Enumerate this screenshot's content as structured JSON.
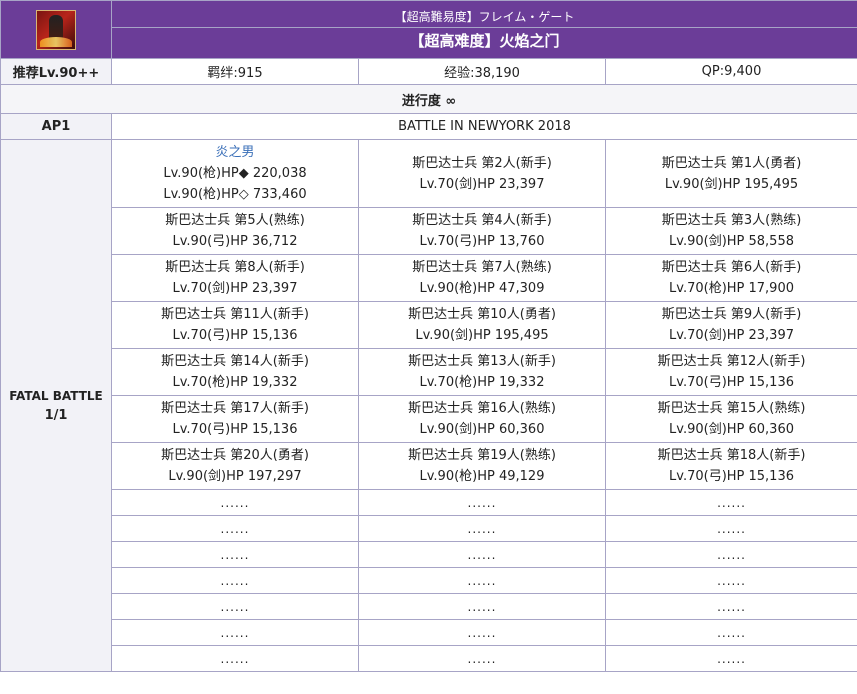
{
  "header": {
    "jp_title": "【超高難易度】フレイム・ゲート",
    "cn_title": "【超高难度】火焰之门",
    "icon": "flame-gate-quest-icon"
  },
  "info": {
    "level": "推荐Lv.90++",
    "bond": "羁绊:915",
    "exp": "经验:38,190",
    "qp": "QP:9,400"
  },
  "progress": "进行度 ∞",
  "ap": {
    "label": "AP1",
    "battle_name": "BATTLE IN NEWYORK 2018"
  },
  "fatal": {
    "label": "FATAL BATTLE",
    "ratio": "1/1"
  },
  "enemies": [
    [
      {
        "name": "炎之男",
        "lines": [
          "Lv.90(枪)HP◆ 220,038",
          "Lv.90(枪)HP◇ 733,460"
        ],
        "link": true
      },
      {
        "name": "斯巴达士兵 第2人(新手)",
        "lines": [
          "Lv.70(剑)HP 23,397"
        ]
      },
      {
        "name": "斯巴达士兵 第1人(勇者)",
        "lines": [
          "Lv.90(剑)HP 195,495"
        ]
      }
    ],
    [
      {
        "name": "斯巴达士兵 第5人(熟练)",
        "lines": [
          "Lv.90(弓)HP 36,712"
        ]
      },
      {
        "name": "斯巴达士兵 第4人(新手)",
        "lines": [
          "Lv.70(弓)HP 13,760"
        ]
      },
      {
        "name": "斯巴达士兵 第3人(熟练)",
        "lines": [
          "Lv.90(剑)HP 58,558"
        ]
      }
    ],
    [
      {
        "name": "斯巴达士兵 第8人(新手)",
        "lines": [
          "Lv.70(剑)HP 23,397"
        ]
      },
      {
        "name": "斯巴达士兵 第7人(熟练)",
        "lines": [
          "Lv.90(枪)HP 47,309"
        ]
      },
      {
        "name": "斯巴达士兵 第6人(新手)",
        "lines": [
          "Lv.70(枪)HP 17,900"
        ]
      }
    ],
    [
      {
        "name": "斯巴达士兵 第11人(新手)",
        "lines": [
          "Lv.70(弓)HP 15,136"
        ]
      },
      {
        "name": "斯巴达士兵 第10人(勇者)",
        "lines": [
          "Lv.90(剑)HP 195,495"
        ]
      },
      {
        "name": "斯巴达士兵 第9人(新手)",
        "lines": [
          "Lv.70(剑)HP 23,397"
        ]
      }
    ],
    [
      {
        "name": "斯巴达士兵 第14人(新手)",
        "lines": [
          "Lv.70(枪)HP 19,332"
        ]
      },
      {
        "name": "斯巴达士兵 第13人(新手)",
        "lines": [
          "Lv.70(枪)HP 19,332"
        ]
      },
      {
        "name": "斯巴达士兵 第12人(新手)",
        "lines": [
          "Lv.70(弓)HP 15,136"
        ]
      }
    ],
    [
      {
        "name": "斯巴达士兵 第17人(新手)",
        "lines": [
          "Lv.70(弓)HP 15,136"
        ]
      },
      {
        "name": "斯巴达士兵 第16人(熟练)",
        "lines": [
          "Lv.90(剑)HP 60,360"
        ]
      },
      {
        "name": "斯巴达士兵 第15人(熟练)",
        "lines": [
          "Lv.90(剑)HP 60,360"
        ]
      }
    ],
    [
      {
        "name": "斯巴达士兵 第20人(勇者)",
        "lines": [
          "Lv.90(剑)HP 197,297"
        ]
      },
      {
        "name": "斯巴达士兵 第19人(熟练)",
        "lines": [
          "Lv.90(枪)HP 49,129"
        ]
      },
      {
        "name": "斯巴达士兵 第18人(新手)",
        "lines": [
          "Lv.70(弓)HP 15,136"
        ]
      }
    ]
  ],
  "ellipsis": "......",
  "ellipsis_rows": 7
}
